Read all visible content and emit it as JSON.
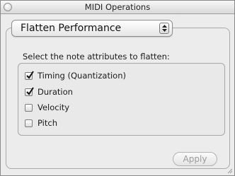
{
  "window": {
    "title": "MIDI Operations"
  },
  "operation": {
    "selected": "Flatten Performance"
  },
  "attributes": {
    "prompt": "Select the note attributes to flatten:",
    "items": [
      {
        "label": "Timing (Quantization)",
        "checked": true
      },
      {
        "label": "Duration",
        "checked": true
      },
      {
        "label": "Velocity",
        "checked": false
      },
      {
        "label": "Pitch",
        "checked": false
      }
    ]
  },
  "footer": {
    "apply_label": "Apply",
    "apply_enabled": false
  }
}
